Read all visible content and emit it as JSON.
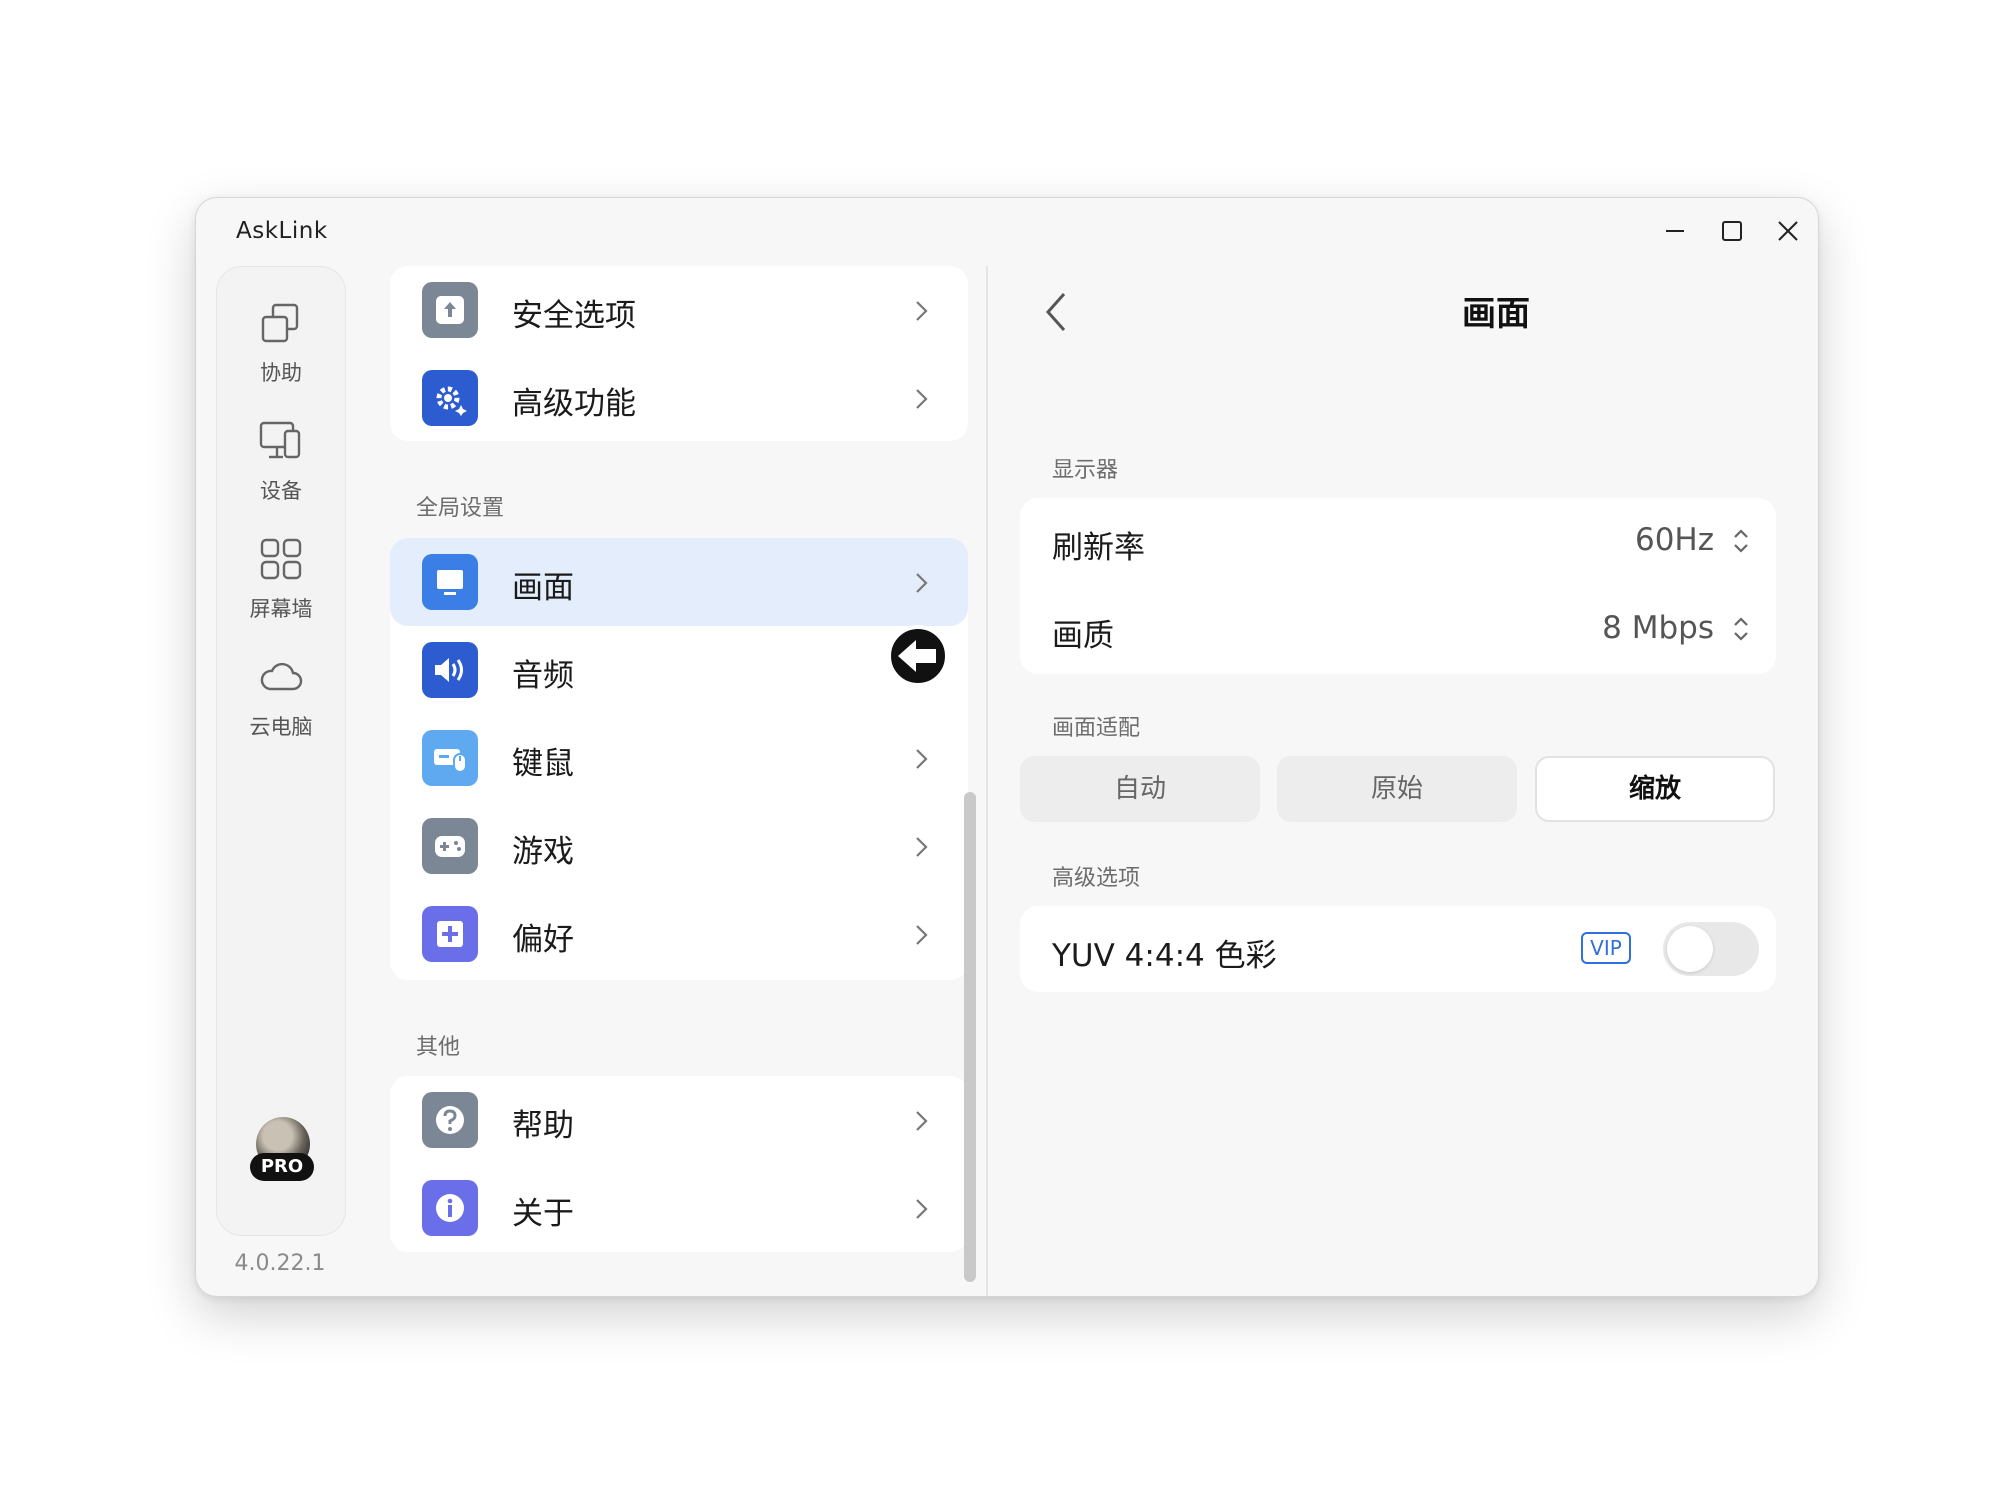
{
  "window": {
    "title": "AskLink"
  },
  "rail": {
    "items": [
      {
        "label": "协助",
        "icon": "collaborate-icon"
      },
      {
        "label": "设备",
        "icon": "devices-icon"
      },
      {
        "label": "屏幕墙",
        "icon": "screen-wall-icon"
      },
      {
        "label": "云电脑",
        "icon": "cloud-icon"
      }
    ],
    "badge": "PRO",
    "version": "4.0.22.1"
  },
  "menu": {
    "top_items": [
      {
        "label": "安全选项",
        "icon": "security-upload-icon",
        "color": "#7b8794"
      },
      {
        "label": "高级功能",
        "icon": "gear-sparkle-icon",
        "color": "#2d5bd0"
      }
    ],
    "global_title": "全局设置",
    "global_items": [
      {
        "label": "画面",
        "icon": "monitor-icon",
        "color": "#3b7ee6",
        "active": true
      },
      {
        "label": "音频",
        "icon": "speaker-icon",
        "color": "#2d5bd0"
      },
      {
        "label": "键鼠",
        "icon": "keyboard-mouse-icon",
        "color": "#5ea9ef"
      },
      {
        "label": "游戏",
        "icon": "gamepad-icon",
        "color": "#7b8794"
      },
      {
        "label": "偏好",
        "icon": "plus-box-icon",
        "color": "#6a6ee8"
      }
    ],
    "other_title": "其他",
    "other_items": [
      {
        "label": "帮助",
        "icon": "help-icon",
        "color": "#7b8794"
      },
      {
        "label": "关于",
        "icon": "info-icon",
        "color": "#6a6ee8"
      }
    ]
  },
  "detail": {
    "title": "画面",
    "display_section": "显示器",
    "refresh_label": "刷新率",
    "refresh_value": "60Hz",
    "quality_label": "画质",
    "quality_value": "8 Mbps",
    "fit_section": "画面适配",
    "fit_options": [
      "自动",
      "原始",
      "缩放"
    ],
    "fit_selected": "缩放",
    "advanced_section": "高级选项",
    "yuv_label": "YUV 4:4:4 色彩",
    "yuv_badge": "VIP",
    "yuv_enabled": false,
    "accent": "#2f6fe0"
  }
}
